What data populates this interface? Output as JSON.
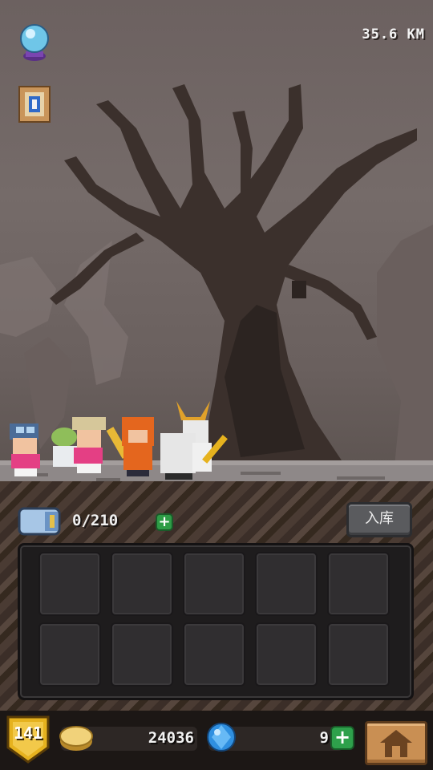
{
  "hud": {
    "distance": "35.6 KM",
    "crystal_orb_icon": "crystal-ball-icon",
    "quest_scroll_icon": "scroll-icon"
  },
  "inventory": {
    "count": "0/210",
    "expand_label": "+",
    "store_button_label": "入库",
    "slots_rows": 2,
    "slots_cols": 5
  },
  "bottom_bar": {
    "level": "141",
    "coins": "24036",
    "gems": "9",
    "gem_plus_label": "+",
    "home_icon": "home-icon"
  },
  "colors": {
    "sky": "#756b69",
    "tree": "#3a302d",
    "ground": "#8d8787",
    "accent_green": "#2ea04b",
    "level_gold": "#e6b21e"
  }
}
